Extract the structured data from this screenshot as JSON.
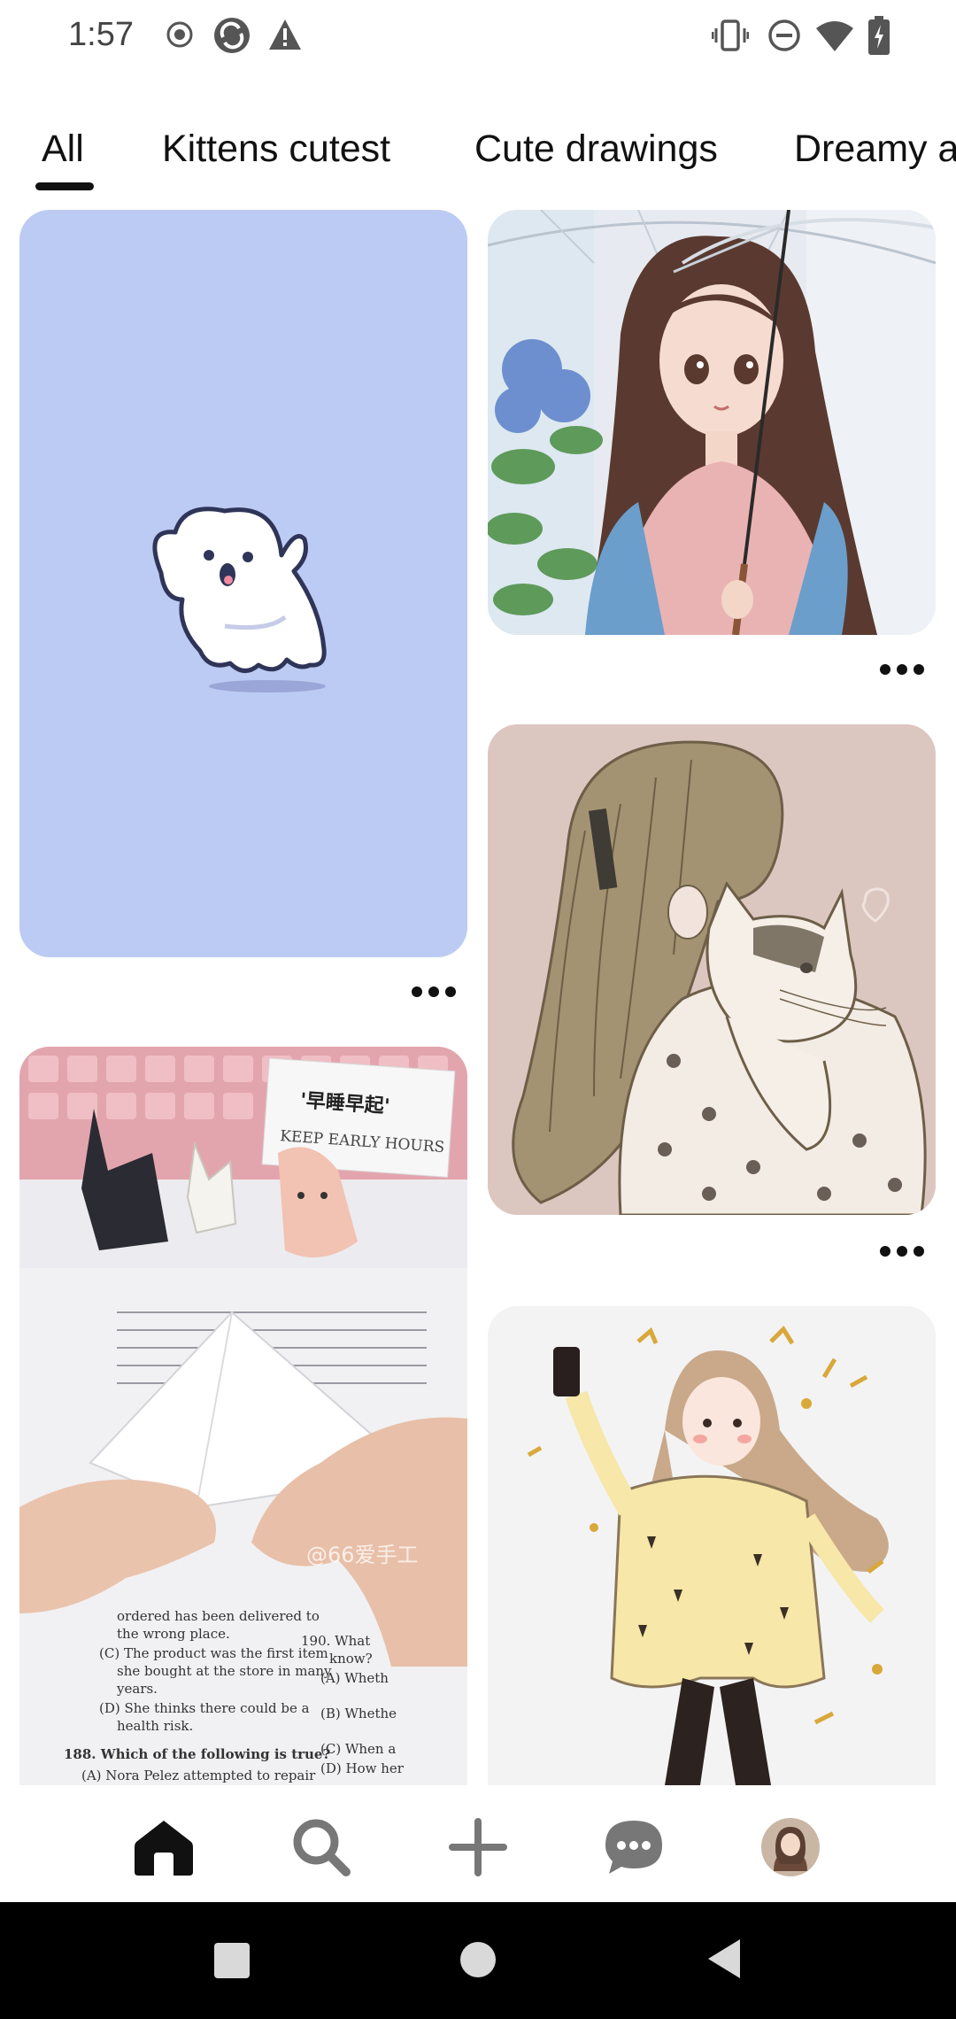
{
  "status_bar": {
    "time": "1:57",
    "left_icons": [
      "record-icon",
      "sync-icon",
      "warning-icon"
    ],
    "right_icons": [
      "vibrate-icon",
      "do-not-disturb-icon",
      "wifi-icon",
      "battery-charging-icon"
    ]
  },
  "tabs": [
    {
      "label": "All",
      "selected": true
    },
    {
      "label": "Kittens cutest",
      "selected": false
    },
    {
      "label": "Cute drawings",
      "selected": false
    },
    {
      "label": "Dreamy a",
      "selected": false
    }
  ],
  "feed": {
    "pins": [
      {
        "id": "ghost",
        "description": "Cute ghost illustration on lavender background"
      },
      {
        "id": "umbrella-girl",
        "description": "Anime girl with umbrella and hydrangeas"
      },
      {
        "id": "girl-with-cat",
        "description": "Sketch of long-haired girl holding a cat"
      },
      {
        "id": "origami",
        "description": "Hands folding paper origami over a textbook page",
        "note_text": "'早睡早起' KEEP EARLY HOURS",
        "watermark": "@66爱手工"
      },
      {
        "id": "selfie-girl",
        "description": "Girl in yellow cardigan taking selfie"
      }
    ]
  },
  "bottom_nav": {
    "items": [
      {
        "name": "home",
        "icon": "home-icon",
        "active": true
      },
      {
        "name": "search",
        "icon": "search-icon",
        "active": false
      },
      {
        "name": "create",
        "icon": "plus-icon",
        "active": false
      },
      {
        "name": "messages",
        "icon": "chat-bubble-icon",
        "active": false
      },
      {
        "name": "profile",
        "icon": "avatar",
        "active": false
      }
    ]
  },
  "system_nav": [
    "recents-square-icon",
    "home-circle-icon",
    "back-triangle-icon"
  ],
  "colors": {
    "ghost_bg": "#bccbf3",
    "selected_tab_underline": "#111111",
    "system_nav_bg": "#000000"
  }
}
